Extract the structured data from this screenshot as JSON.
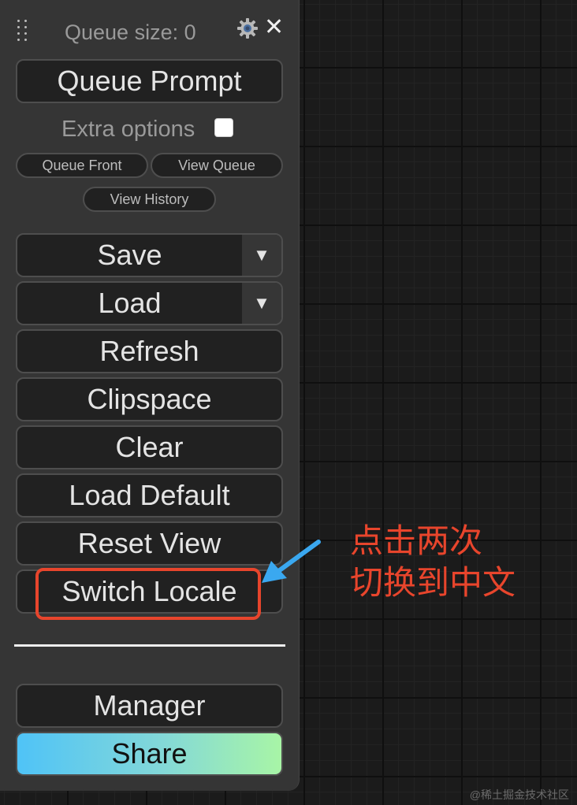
{
  "menu": {
    "queue_size": "Queue size: 0",
    "queue_prompt": "Queue Prompt",
    "extra_options_label": "Extra options",
    "extra_options_checked": false,
    "small_buttons": {
      "queue_front": "Queue Front",
      "view_queue": "View Queue",
      "view_history": "View History"
    },
    "save": "Save",
    "load": "Load",
    "dropdown_glyph": "▼",
    "refresh": "Refresh",
    "clipspace": "Clipspace",
    "clear": "Clear",
    "load_default": "Load Default",
    "reset_view": "Reset View",
    "switch_locale": "Switch Locale",
    "manager": "Manager",
    "share": "Share",
    "close_glyph": "✕"
  },
  "annotation": {
    "line1": "点击两次",
    "line2": "切换到中文",
    "color": "#e8452c",
    "arrow_color": "#3aa8f0"
  },
  "watermark": "@稀土掘金技术社区",
  "colors": {
    "panel_bg": "#353535",
    "button_bg": "#212121",
    "canvas_bg": "#1b1b1b",
    "share_gradient": [
      "#4fc3f7",
      "#a8f5a6"
    ]
  }
}
